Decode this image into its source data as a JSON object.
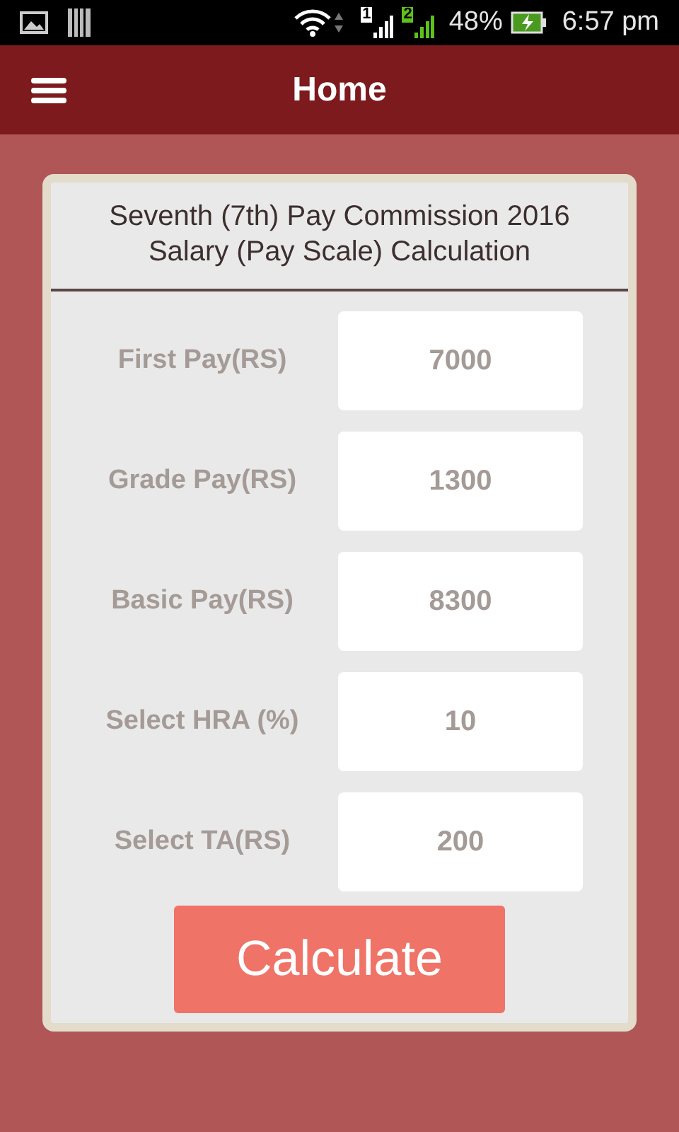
{
  "status_bar": {
    "signals": [
      {
        "label": "1",
        "color": "#ffffff"
      },
      {
        "label": "2",
        "color": "#5cc21a"
      }
    ],
    "battery": "48%",
    "time": "6:57 pm"
  },
  "app_bar": {
    "title": "Home"
  },
  "card": {
    "title": "Seventh (7th) Pay Commission 2016 Salary (Pay Scale) Calculation",
    "fields": [
      {
        "label": "First Pay(RS)",
        "value": "7000"
      },
      {
        "label": "Grade Pay(RS)",
        "value": "1300"
      },
      {
        "label": "Basic Pay(RS)",
        "value": "8300"
      },
      {
        "label": "Select HRA (%)",
        "value": "10"
      },
      {
        "label": "Select TA(RS)",
        "value": "200"
      }
    ],
    "button": "Calculate"
  }
}
